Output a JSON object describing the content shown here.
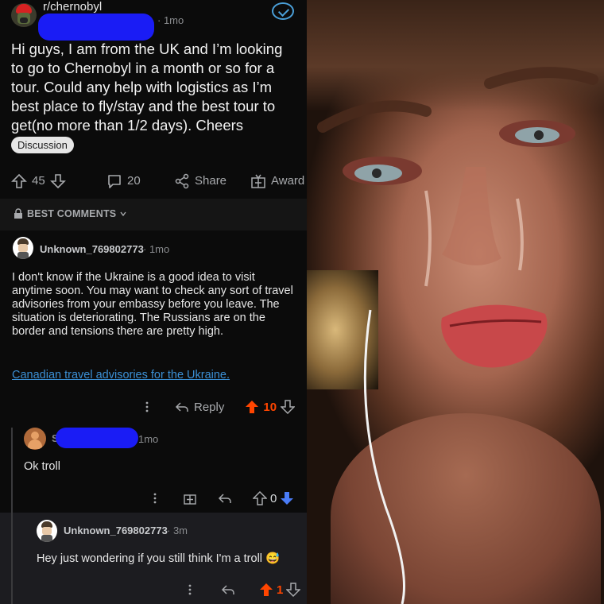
{
  "post": {
    "subreddit": "r/chernobyl",
    "time": "1mo",
    "title": "Hi guys, I am from the UK and I’m looking to go to Chernobyl in a month or so for a tour. Could any help with logistics as I’m best place to fly/stay and the best tour to get(no more than 1/2 days). Cheers",
    "flair": "Discussion",
    "upvotes": "45",
    "comments": "20",
    "share_label": "Share",
    "award_label": "Award"
  },
  "sort": {
    "label": "BEST COMMENTS"
  },
  "comments": [
    {
      "username": "Unknown_769802773",
      "time": "1mo",
      "body": "I don't know if the Ukraine is a good idea to visit anytime soon. You may want to check any sort of travel advisories from your embassy before you leave. The situation is deteriorating. The Russians are on the border and tensions there are pretty high.",
      "link": "Canadian travel advisories for the Ukraine.",
      "reply_label": "Reply",
      "votes": "10"
    },
    {
      "username_initial": "S",
      "time": "1mo",
      "body": "Ok troll",
      "votes": "0"
    },
    {
      "username": "Unknown_769802773",
      "time": "3m",
      "body": "Hey just wondering if you still think I'm a troll",
      "emoji": "😅",
      "votes": "1"
    }
  ],
  "colors": {
    "upvote": "#ff4500",
    "downvote": "#4a7cf7",
    "redaction": "#1a1cf5",
    "link": "#3b8fd4"
  },
  "icons": [
    "upvote-arrow-icon",
    "downvote-arrow-icon",
    "comment-bubble-icon",
    "share-icon",
    "award-icon",
    "more-dots-icon",
    "reply-arrow-icon",
    "lock-icon",
    "chevron-down-icon",
    "verified-check-icon"
  ]
}
